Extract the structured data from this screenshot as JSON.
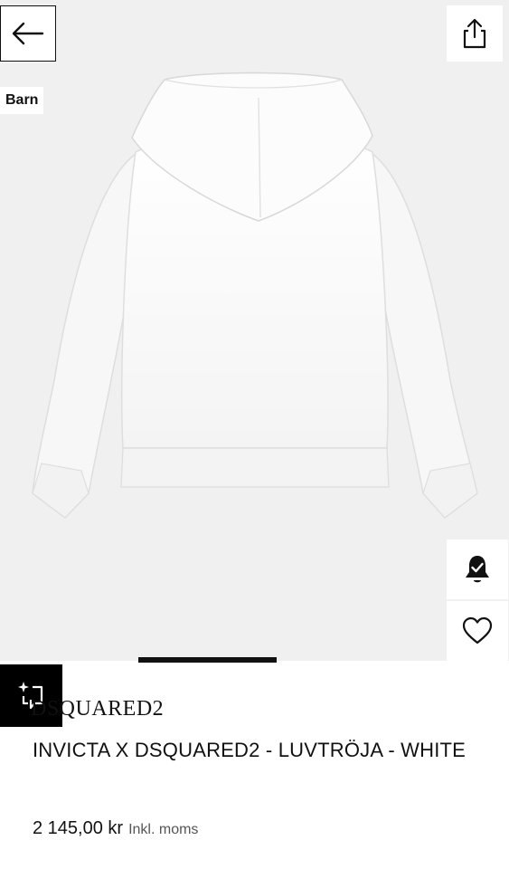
{
  "header": {
    "tag": "Barn"
  },
  "product": {
    "brand": "DSQUARED2",
    "title": "INVICTA X DSQUARED2 - LUVTRÖJA - WHITE",
    "price": "2 145,00 kr",
    "tax_note": "Inkl. moms"
  },
  "icons": {
    "back": "arrow-left-icon",
    "share": "share-icon",
    "notify": "bell-check-icon",
    "wishlist": "heart-icon",
    "try_on": "ar-sparkle-icon"
  },
  "colors": {
    "hero_bg": "#f0f0f0",
    "garment": "#fafafa",
    "accent": "#111111"
  }
}
